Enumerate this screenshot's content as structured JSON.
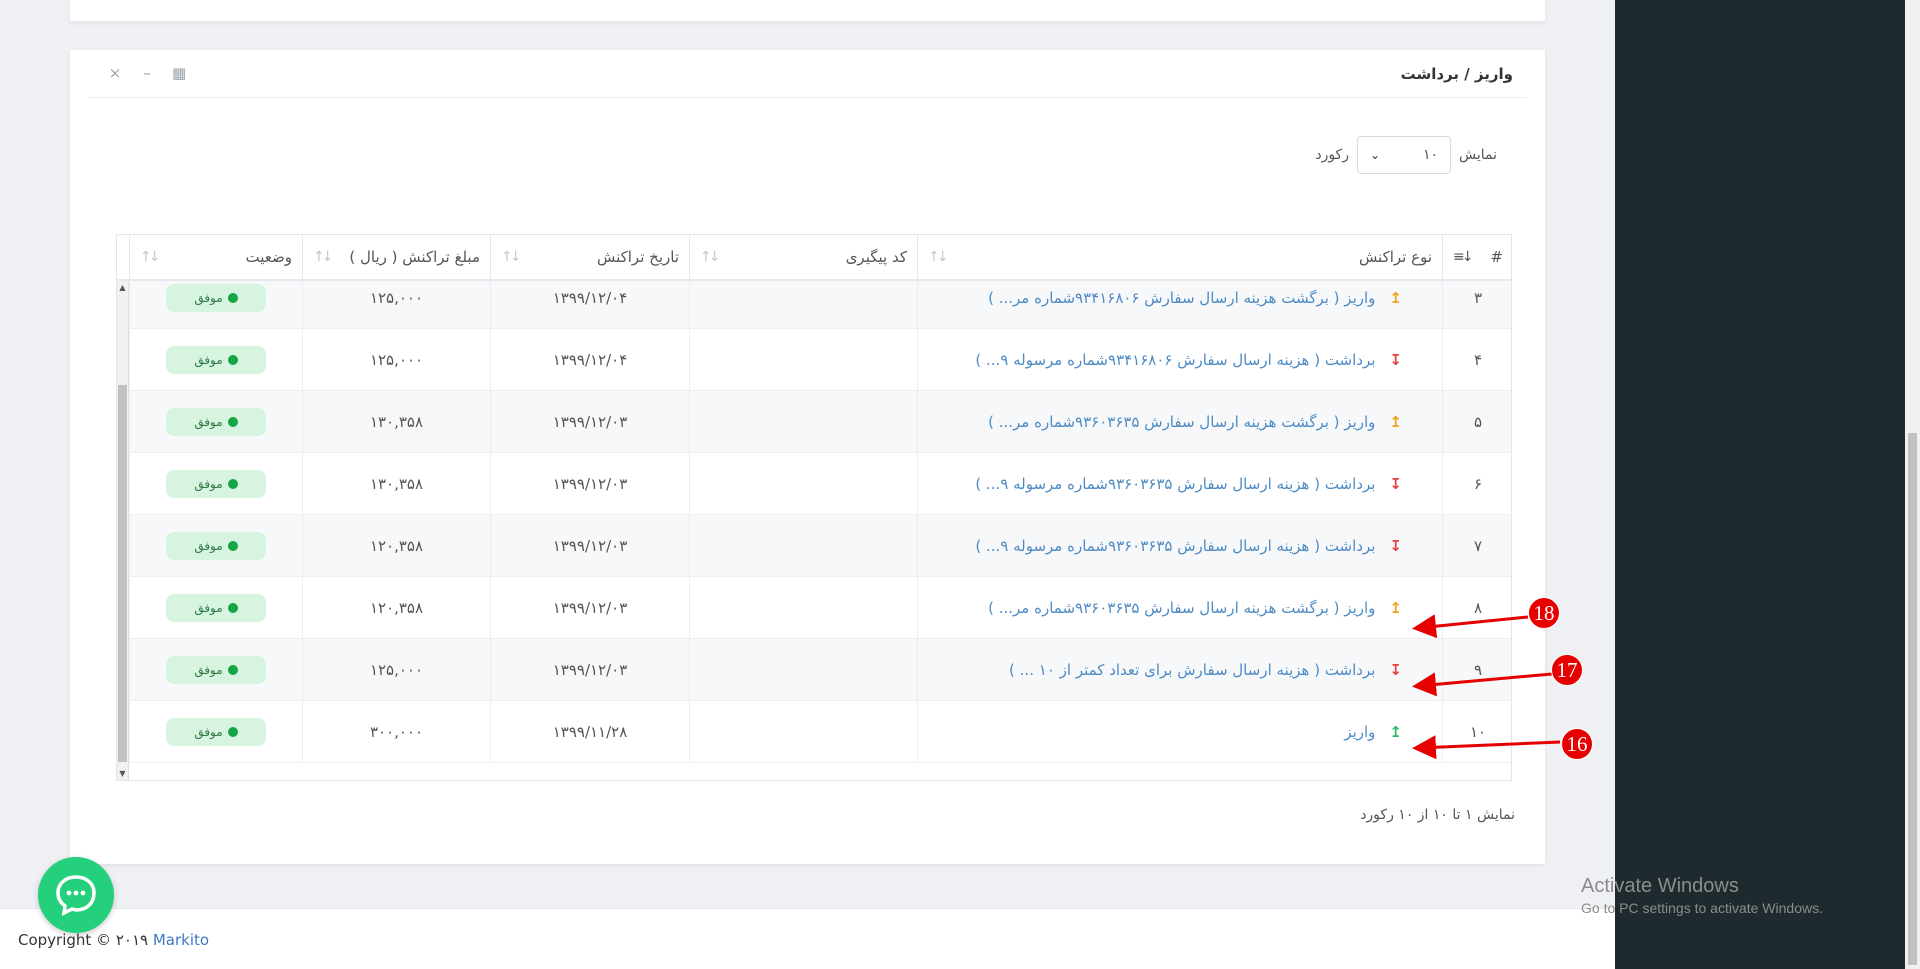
{
  "panel": {
    "title": "واریز / برداشت",
    "tools": {
      "table_icon": "▦",
      "minimize_icon": "–",
      "close_icon": "×"
    }
  },
  "length": {
    "label_show": "نمایش",
    "value": "۱۰",
    "label_record": "رکورد"
  },
  "columns": {
    "index": "#",
    "type": "نوع تراکنش",
    "tracking": "کد پیگیری",
    "date": "تاریخ تراکنش",
    "amount": "مبلغ تراکنش ( ریال )",
    "status": "وضعیت"
  },
  "rows": [
    {
      "index": "۳",
      "direction": "up",
      "type": "واریز ( برگشت هزینه ارسال سفارش ۹۳۴۱۶۸۰۶شماره مر... )",
      "tracking": "",
      "date": "۱۳۹۹/۱۲/۰۴",
      "amount": "۱۲۵,۰۰۰",
      "status": "موفق"
    },
    {
      "index": "۴",
      "direction": "down",
      "type": "برداشت ( هزینه ارسال سفارش ۹۳۴۱۶۸۰۶شماره مرسوله ۹... )",
      "tracking": "",
      "date": "۱۳۹۹/۱۲/۰۴",
      "amount": "۱۲۵,۰۰۰",
      "status": "موفق"
    },
    {
      "index": "۵",
      "direction": "up",
      "type": "واریز ( برگشت هزینه ارسال سفارش ۹۳۶۰۳۶۳۵شماره مر... )",
      "tracking": "",
      "date": "۱۳۹۹/۱۲/۰۳",
      "amount": "۱۳۰,۳۵۸",
      "status": "موفق"
    },
    {
      "index": "۶",
      "direction": "down",
      "type": "برداشت ( هزینه ارسال سفارش ۹۳۶۰۳۶۳۵شماره مرسوله ۹... )",
      "tracking": "",
      "date": "۱۳۹۹/۱۲/۰۳",
      "amount": "۱۳۰,۳۵۸",
      "status": "موفق"
    },
    {
      "index": "۷",
      "direction": "down",
      "type": "برداشت ( هزینه ارسال سفارش ۹۳۶۰۳۶۳۵شماره مرسوله ۹... )",
      "tracking": "",
      "date": "۱۳۹۹/۱۲/۰۳",
      "amount": "۱۲۰,۳۵۸",
      "status": "موفق"
    },
    {
      "index": "۸",
      "direction": "up",
      "type": "واریز ( برگشت هزینه ارسال سفارش ۹۳۶۰۳۶۳۵شماره مر... )",
      "tracking": "",
      "date": "۱۳۹۹/۱۲/۰۳",
      "amount": "۱۲۰,۳۵۸",
      "status": "موفق"
    },
    {
      "index": "۹",
      "direction": "down",
      "type": "برداشت ( هزینه ارسال سفارش برای تعداد کمتر از ۱۰ ... )",
      "tracking": "",
      "date": "۱۳۹۹/۱۲/۰۳",
      "amount": "۱۲۵,۰۰۰",
      "status": "موفق"
    },
    {
      "index": "۱۰",
      "direction": "green",
      "type": "واریز",
      "tracking": "",
      "date": "۱۳۹۹/۱۱/۲۸",
      "amount": "۳۰۰,۰۰۰",
      "status": "موفق"
    }
  ],
  "arrow_glyphs": {
    "up": "↥",
    "down": "↧",
    "green": "↥"
  },
  "info": "نمایش ۱ تا ۱۰ از ۱۰ رکورد",
  "annotations": [
    "18",
    "17",
    "16"
  ],
  "footer": {
    "copyright": "Copyright © ۲۰۱۹",
    "brand": "Markito"
  },
  "watermark": {
    "line1": "Activate Windows",
    "line2": "Go to PC settings to activate Windows."
  },
  "colors": {
    "link": "#4e8bc4",
    "badge_bg": "#d7f4e0",
    "badge_dot": "#14a544",
    "marker": "#e60000",
    "chat": "#25d07c"
  }
}
